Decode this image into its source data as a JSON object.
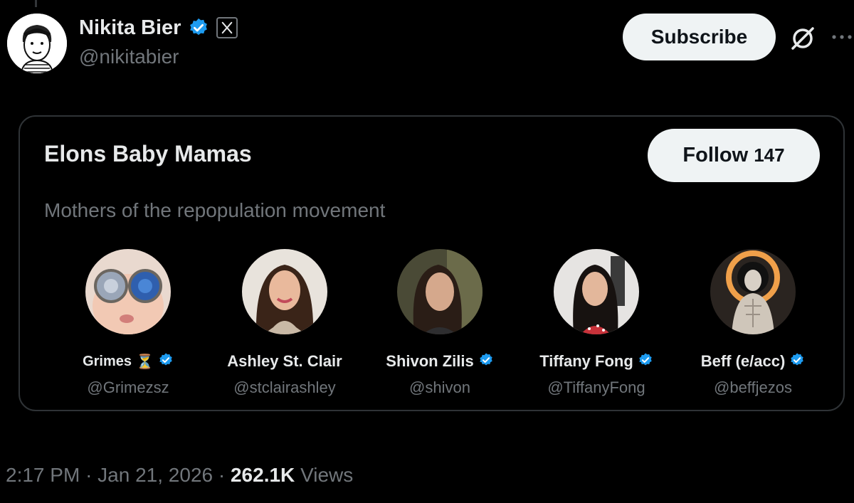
{
  "author": {
    "display_name": "Nikita Bier",
    "handle": "@nikitabier",
    "avatar_icon": "cartoon-portrait-avatar"
  },
  "header": {
    "subscribe_label": "Subscribe",
    "grok_icon": "grok-icon",
    "more_icon": "more-dots-icon"
  },
  "list_card": {
    "title": "Elons Baby Mamas",
    "follow_label": "Follow",
    "follow_count": "147",
    "description": "Mothers of the repopulation movement",
    "members": [
      {
        "name": "Grimes",
        "handle": "@Grimezsz",
        "suffix_icon": "hourglass-icon",
        "verified": true
      },
      {
        "name": "Ashley St. Clair",
        "handle": "@stclairashley",
        "verified": false
      },
      {
        "name": "Shivon Zilis",
        "handle": "@shivon",
        "verified": true
      },
      {
        "name": "Tiffany Fong",
        "handle": "@TiffanyFong",
        "verified": true
      },
      {
        "name": "Beff (e/acc)",
        "handle": "@beffjezos",
        "verified": true
      }
    ]
  },
  "footer": {
    "time": "2:17 PM",
    "date": "Jan 21, 2026",
    "separator": "·",
    "views_count": "262.1K",
    "views_label": "Views"
  },
  "colors": {
    "background": "#000000",
    "text_primary": "#e7e9ea",
    "text_secondary": "#71767b",
    "verified_blue": "#1d9bf0",
    "button_bg": "#eff3f4",
    "card_border": "#2f3336"
  }
}
